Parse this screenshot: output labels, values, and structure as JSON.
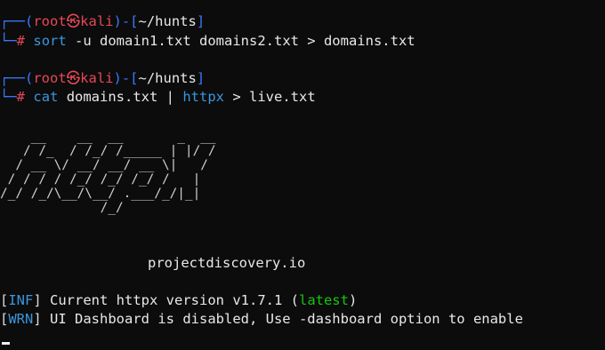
{
  "prompt1": {
    "open": "┌──(",
    "user": "root",
    "sep": "㉿",
    "host": "kali",
    "mid": ")-[",
    "path": "~/hunts",
    "close": "]",
    "prefix": "└─",
    "hash": "#",
    "cmd": "sort",
    "args": " -u domain1.txt domains2.txt > domains.txt"
  },
  "prompt2": {
    "open": "┌──(",
    "user": "root",
    "sep": "㉿",
    "host": "kali",
    "mid": ")-[",
    "path": "~/hunts",
    "close": "]",
    "prefix": "└─",
    "hash": "#",
    "cmd1": "cat",
    "args1": " domains.txt | ",
    "cmd2": "httpx",
    "args2": " > live.txt"
  },
  "logo": [
    "    __    __  __       _  __",
    "   / /_  / /_/ /_____ | |/ /",
    "  / __ \\/ __/ __/ __ \\|   / ",
    " / / / / /_/ /_/ /_/ /   |  ",
    "/_/ /_/\\__/\\__/ .___/_/|_|  ",
    "             /_/            "
  ],
  "domain_credit": "projectdiscovery.io",
  "log": [
    {
      "tag": "INF",
      "text": " Current httpx version v1.7.1 (",
      "status": "latest",
      "end": ")"
    },
    {
      "tag": "WRN",
      "text": " UI Dashboard is disabled, Use -dashboard option to enable"
    }
  ]
}
